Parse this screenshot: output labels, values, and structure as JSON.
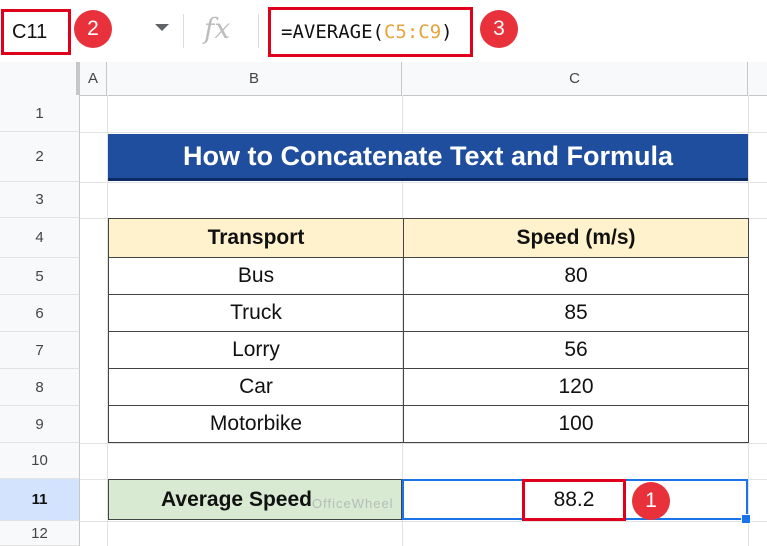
{
  "formula_bar": {
    "name_box": "C11",
    "fx_label": "fx",
    "formula_prefix": "=AVERAGE(",
    "formula_ref": "C5:C9",
    "formula_suffix": ")"
  },
  "callouts": [
    "1",
    "2",
    "3"
  ],
  "columns": [
    "A",
    "B",
    "C"
  ],
  "rows": [
    "1",
    "2",
    "3",
    "4",
    "5",
    "6",
    "7",
    "8",
    "9",
    "10",
    "11",
    "12"
  ],
  "sheet": {
    "title": "How to Concatenate Text and Formula",
    "table": {
      "headers": [
        "Transport",
        "Speed (m/s)"
      ],
      "rows": [
        [
          "Bus",
          "80"
        ],
        [
          "Truck",
          "85"
        ],
        [
          "Lorry",
          "56"
        ],
        [
          "Car",
          "120"
        ],
        [
          "Motorbike",
          "100"
        ]
      ]
    },
    "average_label": "Average Speed",
    "average_value": "88.2"
  },
  "watermark": "OfficeWheel",
  "colors": {
    "title_bg": "#1f4e9e",
    "header_bg": "#fff2cc",
    "average_label_bg": "#d9ead3",
    "highlight_border": "#e0001b",
    "callout_bg": "#e8313a",
    "selection": "#1a73e8"
  }
}
